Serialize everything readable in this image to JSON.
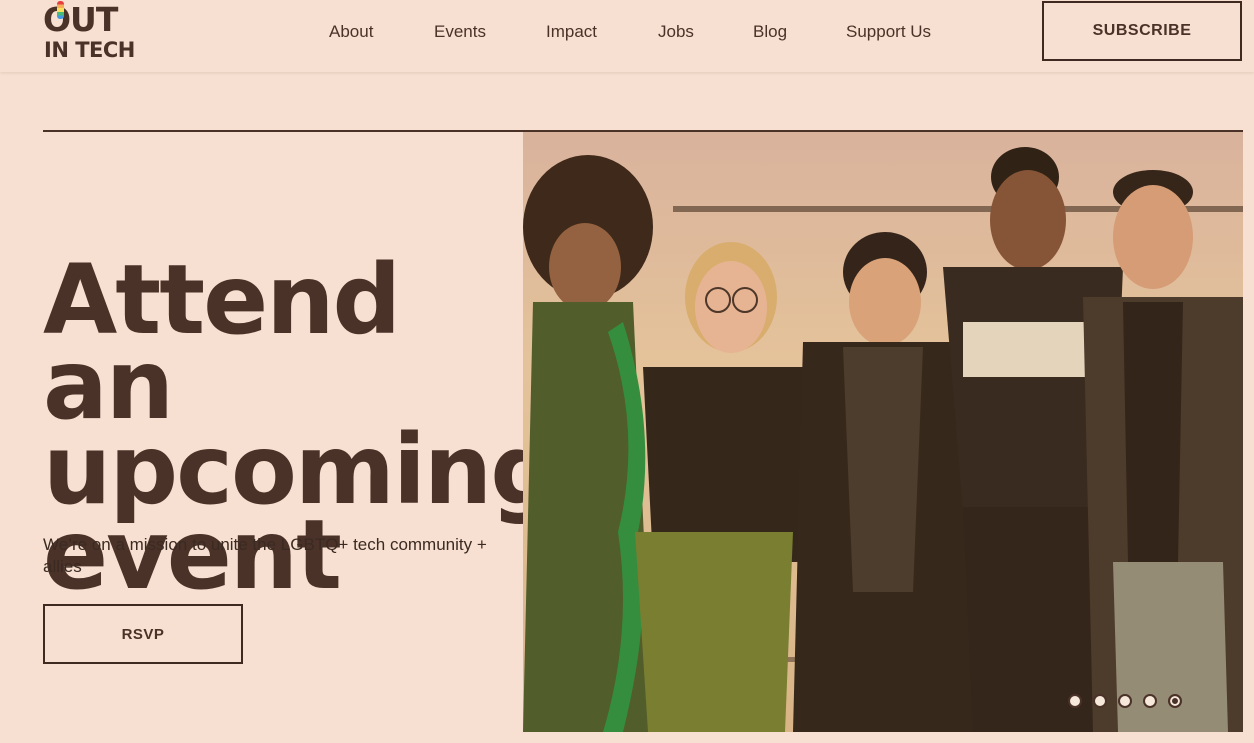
{
  "logo": {
    "line1": "OUT",
    "line2": "IN TECH"
  },
  "nav": [
    {
      "label": "About"
    },
    {
      "label": "Events"
    },
    {
      "label": "Impact"
    },
    {
      "label": "Jobs"
    },
    {
      "label": "Blog"
    },
    {
      "label": "Support Us"
    }
  ],
  "header": {
    "subscribe_label": "SUBSCRIBE"
  },
  "hero": {
    "headline": "Attend an upcoming event",
    "subtext": "We’re on a mission to unite the LGBTQ+ tech community + allies",
    "rsvp_label": "RSVP"
  },
  "carousel": {
    "slide_count": 5,
    "active_index": 4
  },
  "colors": {
    "background": "#f7e0d1",
    "text": "#4a3228",
    "accent_border": "#3f2a21"
  }
}
